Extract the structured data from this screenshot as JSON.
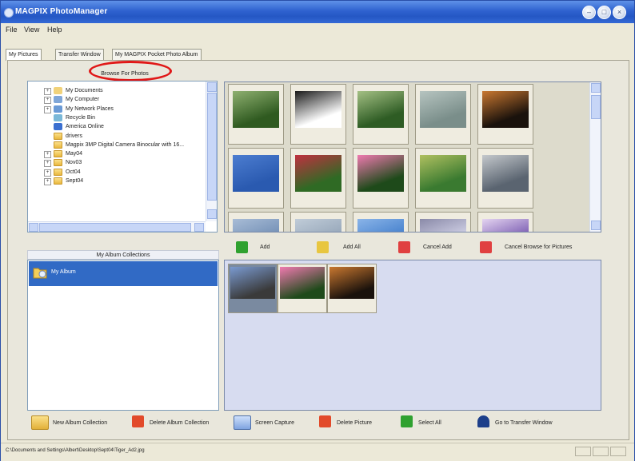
{
  "window": {
    "title": "MAGPIX PhotoManager"
  },
  "menu": [
    "File",
    "View",
    "Help"
  ],
  "tabs": [
    "My Pictures",
    "Transfer Window",
    "My MAGPIX Pocket Photo Album"
  ],
  "browse_title": "Browse For Photos",
  "tree": [
    {
      "label": "My Documents",
      "icon": "documents-icon",
      "expander": "+"
    },
    {
      "label": "My Computer",
      "icon": "computer-icon",
      "expander": "+"
    },
    {
      "label": "My Network Places",
      "icon": "network-icon",
      "expander": "+"
    },
    {
      "label": "Recycle Bin",
      "icon": "recycle-bin-icon",
      "expander": ""
    },
    {
      "label": "America Online",
      "icon": "aol-icon",
      "expander": ""
    },
    {
      "label": "drivers",
      "icon": "folder-icon",
      "expander": ""
    },
    {
      "label": "Magpix 3MP Digital Camera Binocular with 16...",
      "icon": "folder-icon",
      "expander": ""
    },
    {
      "label": "May04",
      "icon": "folder-icon",
      "expander": "+"
    },
    {
      "label": "Nov03",
      "icon": "folder-icon",
      "expander": "+"
    },
    {
      "label": "Oct04",
      "icon": "folder-icon",
      "expander": "+"
    },
    {
      "label": "Sept04",
      "icon": "folder-icon",
      "expander": "+"
    }
  ],
  "thumbnails": [
    {
      "subject": "green trees",
      "colors": [
        "#2f5a20",
        "#8fb070"
      ]
    },
    {
      "subject": "binoculars",
      "colors": [
        "#ffffff",
        "#1a1a1a"
      ]
    },
    {
      "subject": "green trees",
      "colors": [
        "#2e5c24",
        "#a4c084"
      ]
    },
    {
      "subject": "waterfront buildings",
      "colors": [
        "#7a8e8a",
        "#b6c4c0"
      ]
    },
    {
      "subject": "city lights at night",
      "colors": [
        "#1a120c",
        "#c97830"
      ]
    },
    {
      "subject": "airplane in blue sky",
      "colors": [
        "#2a5ab0",
        "#4c7dd0"
      ]
    },
    {
      "subject": "red flowers and green leaves",
      "colors": [
        "#2f6a24",
        "#c03040"
      ]
    },
    {
      "subject": "pink water lily",
      "colors": [
        "#1e4a1a",
        "#f07ab0"
      ]
    },
    {
      "subject": "garden flowers",
      "colors": [
        "#3a7a30",
        "#b0c060"
      ]
    },
    {
      "subject": "city skyline and clouds",
      "colors": [
        "#5a6470",
        "#c4c8cc"
      ]
    },
    {
      "subject": "sky",
      "colors": [
        "#6a88b0",
        "#a8bcd6"
      ]
    },
    {
      "subject": "sky",
      "colors": [
        "#8fa0b4",
        "#c0ccd8"
      ]
    },
    {
      "subject": "blue sky",
      "colors": [
        "#3a78c8",
        "#8ab4e8"
      ]
    },
    {
      "subject": "objects",
      "colors": [
        "#dcdcf0",
        "#8a8aa8"
      ]
    },
    {
      "subject": "purple box",
      "colors": [
        "#6a4aa8",
        "#e4d4f0"
      ]
    }
  ],
  "actions": [
    {
      "label": "Add",
      "icon": "add-arrow-icon",
      "color": "#2fa12f"
    },
    {
      "label": "Add All",
      "icon": "add-all-icon",
      "color": "#e8c640"
    },
    {
      "label": "Cancel Add",
      "icon": "cancel-add-icon",
      "color": "#e04040"
    },
    {
      "label": "Cancel Browse for Pictures",
      "icon": "cancel-browse-icon",
      "color": "#e04040"
    }
  ],
  "album": {
    "header": "My Album Collections",
    "items": [
      {
        "label": "My Album"
      }
    ],
    "selected_color": "#316ac5"
  },
  "album_photos": [
    {
      "subject": "airplane",
      "colors": [
        "#3a3a3a",
        "#7a9ad0"
      ],
      "selected": true
    },
    {
      "subject": "pink water lily",
      "colors": [
        "#1e4a1a",
        "#f07ab0"
      ]
    },
    {
      "subject": "city lights at night",
      "colors": [
        "#1a120c",
        "#c97830"
      ]
    }
  ],
  "bottom": [
    {
      "label": "New Album Collection",
      "icon": "new-album-icon"
    },
    {
      "label": "Delete Album Collection",
      "icon": "delete-album-icon"
    },
    {
      "label": "Screen Capture",
      "icon": "screen-capture-icon"
    },
    {
      "label": "Delete Picture",
      "icon": "delete-picture-icon"
    },
    {
      "label": "Select All",
      "icon": "select-all-icon"
    },
    {
      "label": "Go to Transfer Window",
      "icon": "transfer-window-icon"
    }
  ],
  "status": "C:\\Documents and Settings\\Albert\\Desktop\\Sept04\\Tiger_Ad2.jpg"
}
